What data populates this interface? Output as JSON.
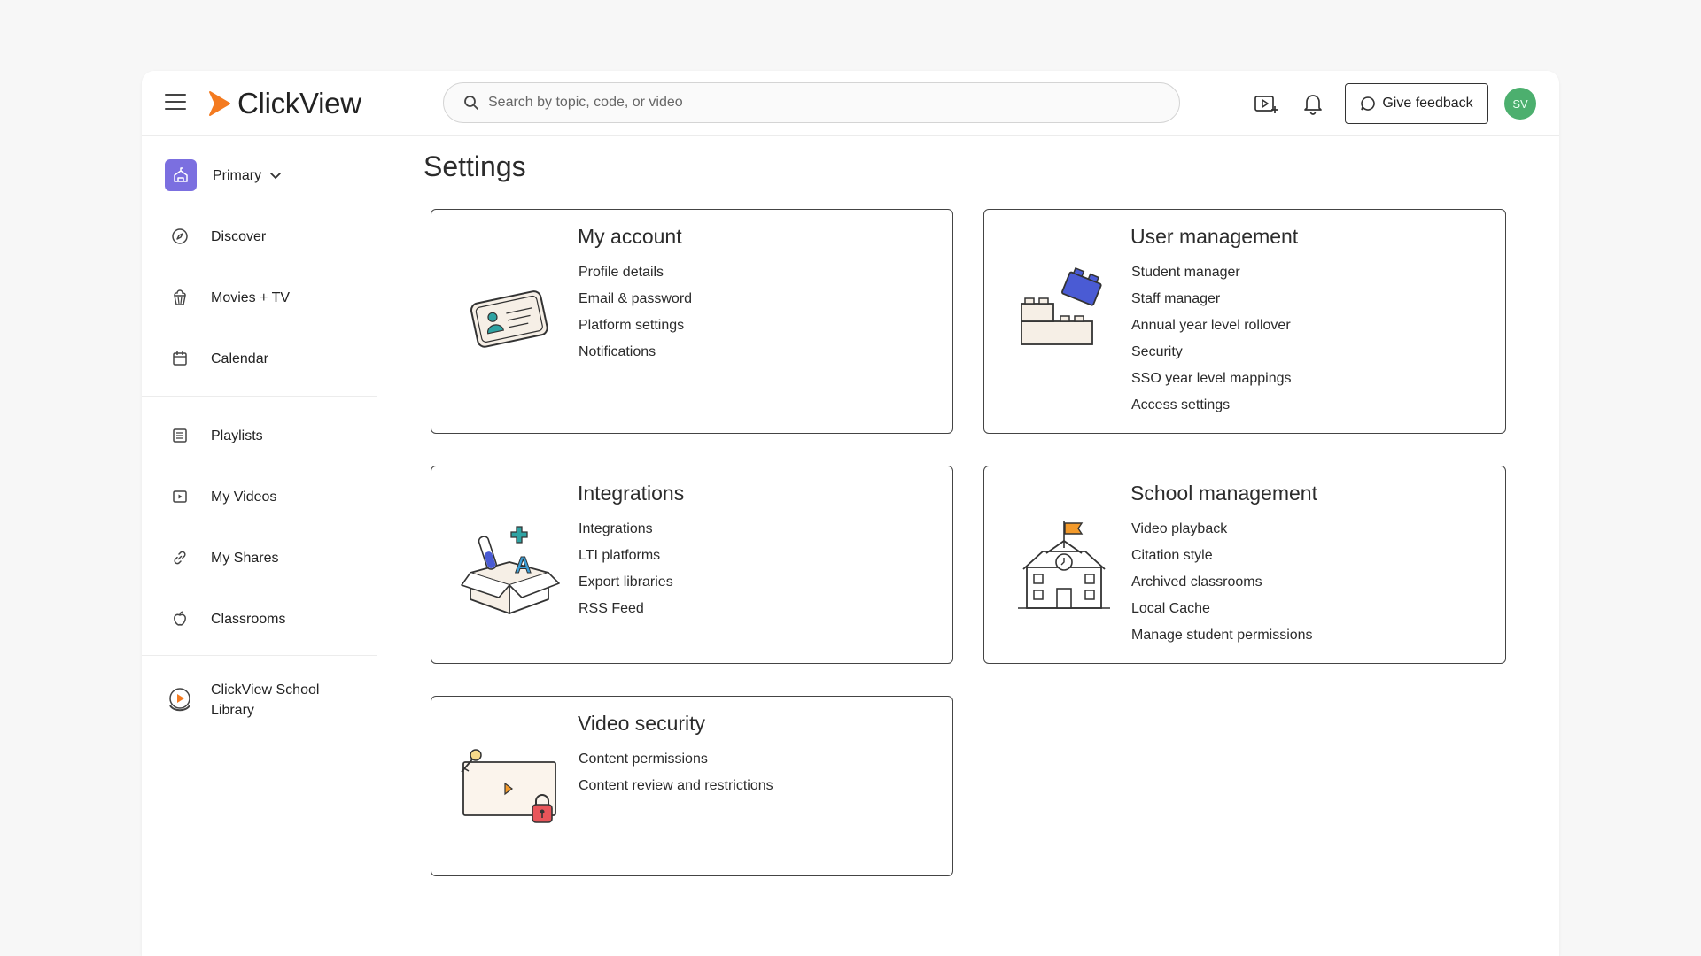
{
  "header": {
    "menu_icon": "hamburger-menu-icon",
    "logo_text": "ClickView",
    "search": {
      "placeholder": "Search by topic, code, or video"
    },
    "feedback_label": "Give feedback",
    "avatar_initials": "SV"
  },
  "sidebar": {
    "primary_label": "Primary",
    "nav_items": [
      {
        "label": "Discover",
        "icon": "compass-icon"
      },
      {
        "label": "Movies + TV",
        "icon": "popcorn-icon"
      },
      {
        "label": "Calendar",
        "icon": "calendar-icon"
      },
      {
        "label": "Playlists",
        "icon": "playlist-icon"
      },
      {
        "label": "My Videos",
        "icon": "video-icon"
      },
      {
        "label": "My Shares",
        "icon": "link-icon"
      },
      {
        "label": "Classrooms",
        "icon": "apple-icon"
      }
    ],
    "library": {
      "line1": "ClickView School",
      "line2": "Library"
    }
  },
  "main": {
    "title": "Settings",
    "cards": [
      {
        "title": "My account",
        "links": [
          "Profile details",
          "Email & password",
          "Platform settings",
          "Notifications"
        ]
      },
      {
        "title": "User management",
        "links": [
          "Student manager",
          "Staff manager",
          "Annual year level rollover",
          "Security",
          "SSO year level mappings",
          "Access settings"
        ]
      },
      {
        "title": "Integrations",
        "links": [
          "Integrations",
          "LTI platforms",
          "Export libraries",
          "RSS Feed"
        ]
      },
      {
        "title": "School management",
        "links": [
          "Video playback",
          "Citation style",
          "Archived classrooms",
          "Local Cache",
          "Manage student permissions"
        ]
      },
      {
        "title": "Video security",
        "links": [
          "Content permissions",
          "Content review and restrictions"
        ]
      }
    ]
  },
  "colors": {
    "brand_orange": "#f47b20",
    "primary_purple": "#7b6fe0",
    "avatar_green": "#4caf6e"
  }
}
